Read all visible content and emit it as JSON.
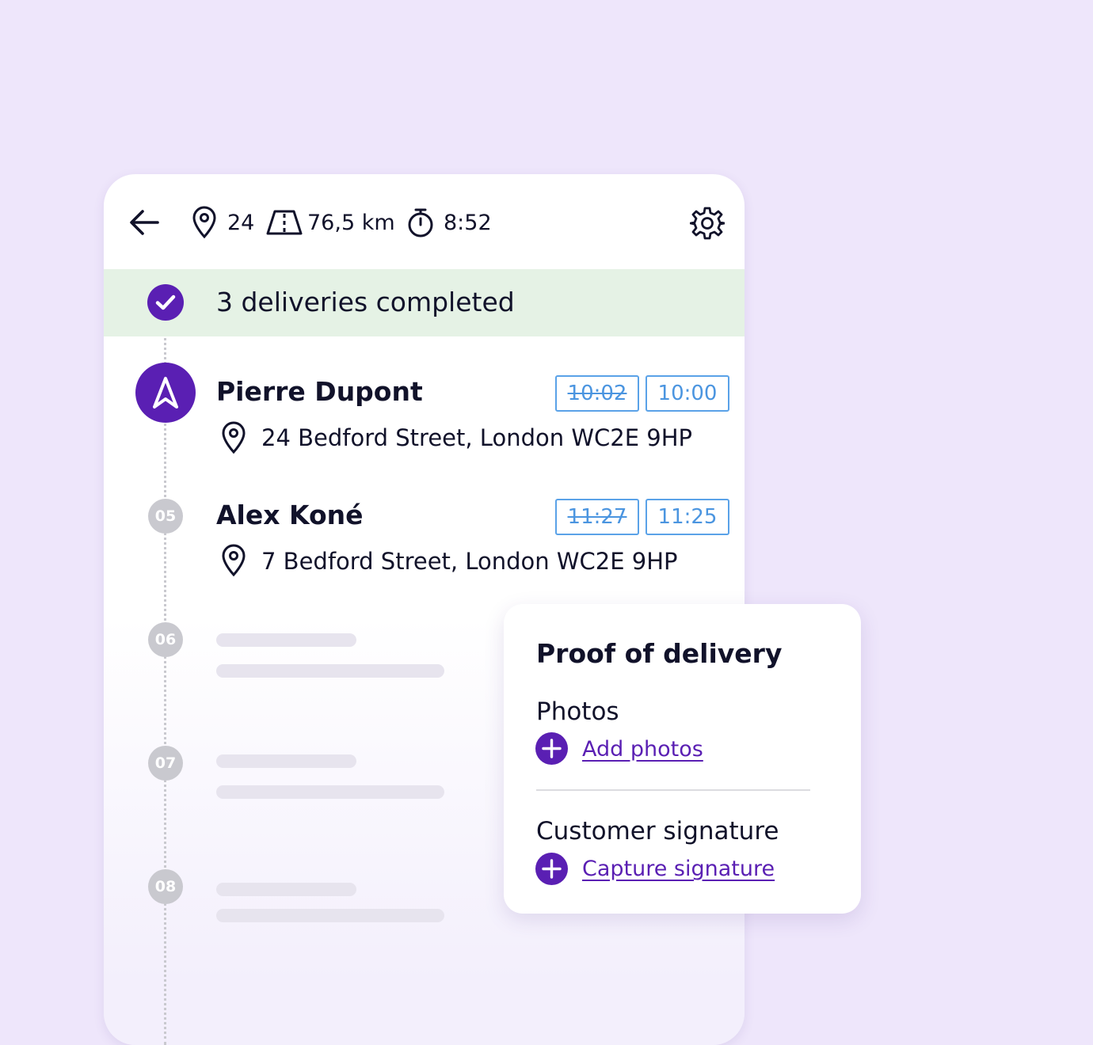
{
  "header": {
    "stops_count": "24",
    "distance": "76,5 km",
    "duration": "8:52",
    "icons": [
      "back-arrow-icon",
      "map-pin-icon",
      "road-icon",
      "stopwatch-icon",
      "gear-icon"
    ]
  },
  "completed_banner": {
    "text": "3 deliveries completed"
  },
  "stops": [
    {
      "name": "Pierre Dupont",
      "planned_time": "10:02",
      "time": "10:00",
      "address": "24 Bedford Street, London WC2E 9HP"
    },
    {
      "number": "05",
      "name": "Alex Koné",
      "planned_time": "11:27",
      "time": "11:25",
      "address": "7 Bedford Street, London WC2E 9HP"
    }
  ],
  "placeholder_stops": [
    {
      "number": "06"
    },
    {
      "number": "07"
    },
    {
      "number": "08"
    }
  ],
  "proof_card": {
    "title": "Proof of delivery",
    "photos_label": "Photos",
    "add_photos_link": "Add photos",
    "signature_label": "Customer signature",
    "capture_signature_link": "Capture signature"
  },
  "colors": {
    "page_background": "#eee6fb",
    "accent_purple": "#5a1fb3",
    "completed_band": "#e5f2e5",
    "time_chip_blue": "#4b95e0",
    "badge_gray": "#c9c9cf"
  }
}
